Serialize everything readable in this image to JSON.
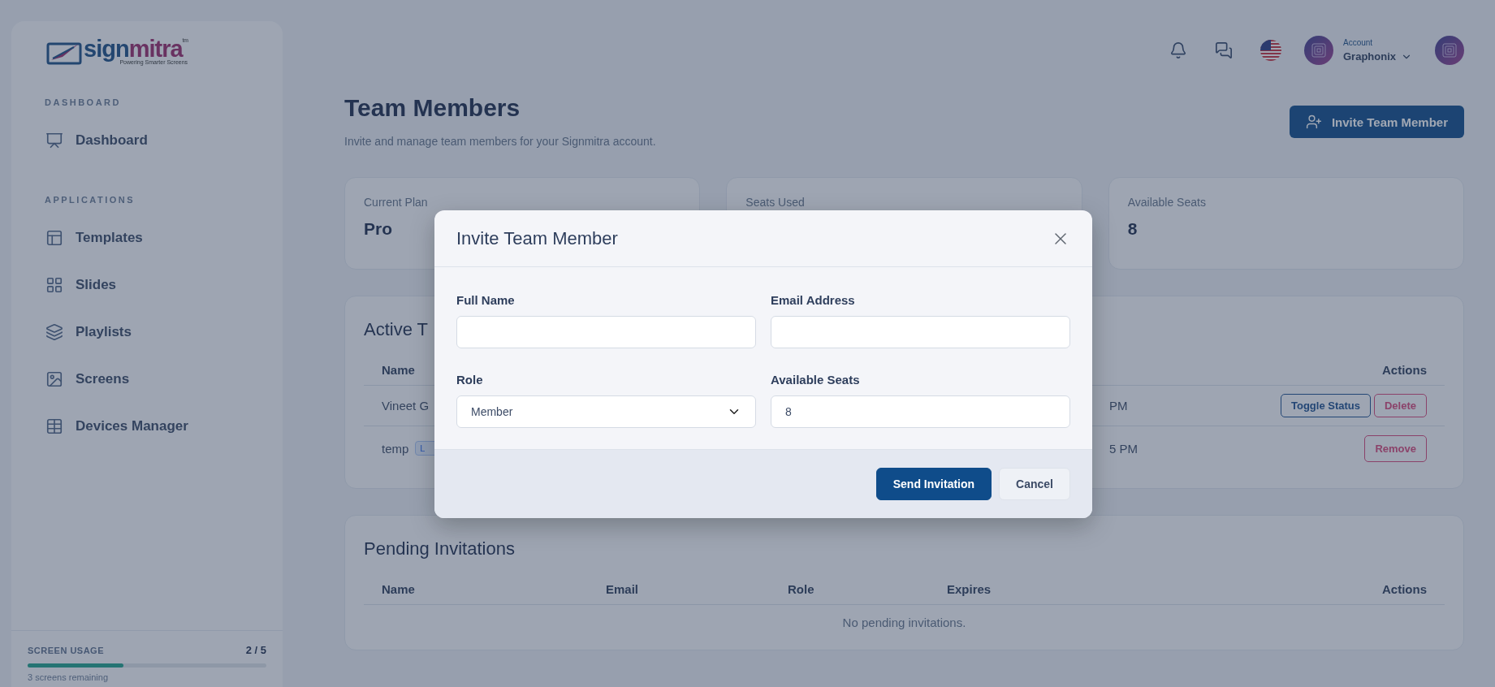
{
  "sidebar": {
    "logo": {
      "word_a": "sign",
      "word_b": "mitra",
      "tagline": "Powering Smarter Screens",
      "mark": "tm"
    },
    "sections": [
      {
        "heading": "DASHBOARD",
        "items": [
          {
            "label": "Dashboard",
            "selected": false
          }
        ]
      },
      {
        "heading": "APPLICATIONS",
        "items": [
          {
            "label": "Templates",
            "selected": false
          },
          {
            "label": "Slides",
            "selected": false
          },
          {
            "label": "Playlists",
            "selected": false
          },
          {
            "label": "Screens",
            "selected": false
          },
          {
            "label": "Devices Manager",
            "selected": false
          }
        ]
      }
    ],
    "usage": {
      "label": "SCREEN USAGE",
      "count": "2 / 5",
      "level": 0.4,
      "note": "3 screens remaining"
    }
  },
  "header": {
    "account_label": "Account",
    "account_name": "Graphonix"
  },
  "page": {
    "title": "Team Members",
    "subtitle": "Invite and manage team members for your Signmitra account.",
    "invite_button": "Invite Team Member"
  },
  "stats": [
    {
      "label": "Current Plan",
      "value": "Pro"
    },
    {
      "label": "Seats Used"
    },
    {
      "label": "Available Seats",
      "value": "8"
    }
  ],
  "active_members": {
    "title": "Active T",
    "columns": [
      "Name",
      "Actions"
    ],
    "rows": [
      {
        "name": "Vineet G",
        "time": "PM",
        "actions": [
          {
            "label": "Toggle Status",
            "kind": "primary"
          },
          {
            "label": "Delete",
            "kind": "danger"
          }
        ]
      },
      {
        "name": "temp",
        "badge": "L",
        "time": "5 PM",
        "actions": [
          {
            "label": "Remove",
            "kind": "danger"
          }
        ]
      }
    ]
  },
  "pending": {
    "title": "Pending Invitations",
    "columns": [
      "Name",
      "Email",
      "Role",
      "Expires",
      "Actions"
    ],
    "empty": "No pending invitations."
  },
  "modal": {
    "title": "Invite Team Member",
    "fields": [
      {
        "label": "Full Name",
        "kind": "text"
      },
      {
        "label": "Email Address",
        "kind": "text"
      },
      {
        "label": "Role",
        "kind": "select",
        "value": "Member"
      },
      {
        "label": "Available Seats",
        "kind": "text",
        "value": "8"
      }
    ],
    "buttons": [
      {
        "label": "Send Invitation",
        "kind": "primary"
      },
      {
        "label": "Cancel",
        "kind": "secondary"
      }
    ]
  }
}
